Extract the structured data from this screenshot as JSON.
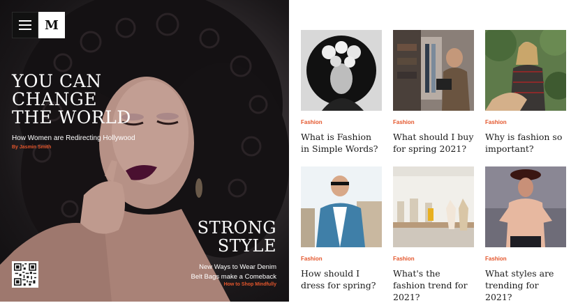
{
  "brand": {
    "logo_letter": "M"
  },
  "hero": {
    "headline_lines": [
      "YOU CAN",
      "CHANGE",
      "THE WORLD"
    ],
    "subtitle": "How Women are Redirecting Hollywood",
    "byline": "By Jasmin Smith",
    "feature_lines": [
      "STRONG",
      "STYLE"
    ],
    "feature_sub_lines": [
      "New Ways to Wear Denim",
      "Belt Bags make a Comeback"
    ],
    "feature_link": "How to Shop Mindfully"
  },
  "articles": [
    {
      "category": "Fashion",
      "title": "What is Fashion in Simple Words?"
    },
    {
      "category": "Fashion",
      "title": "What should I buy for spring 2021?"
    },
    {
      "category": "Fashion",
      "title": "Why is fashion so important?"
    },
    {
      "category": "Fashion",
      "title": "How should I dress for spring?"
    },
    {
      "category": "Fashion",
      "title": "What's the fashion trend for 2021?"
    },
    {
      "category": "Fashion",
      "title": "What styles are trending for 2021?"
    }
  ],
  "colors": {
    "accent": "#e4562c",
    "hero_bg": "#1a1719",
    "text_dark": "#1a1a1a"
  }
}
